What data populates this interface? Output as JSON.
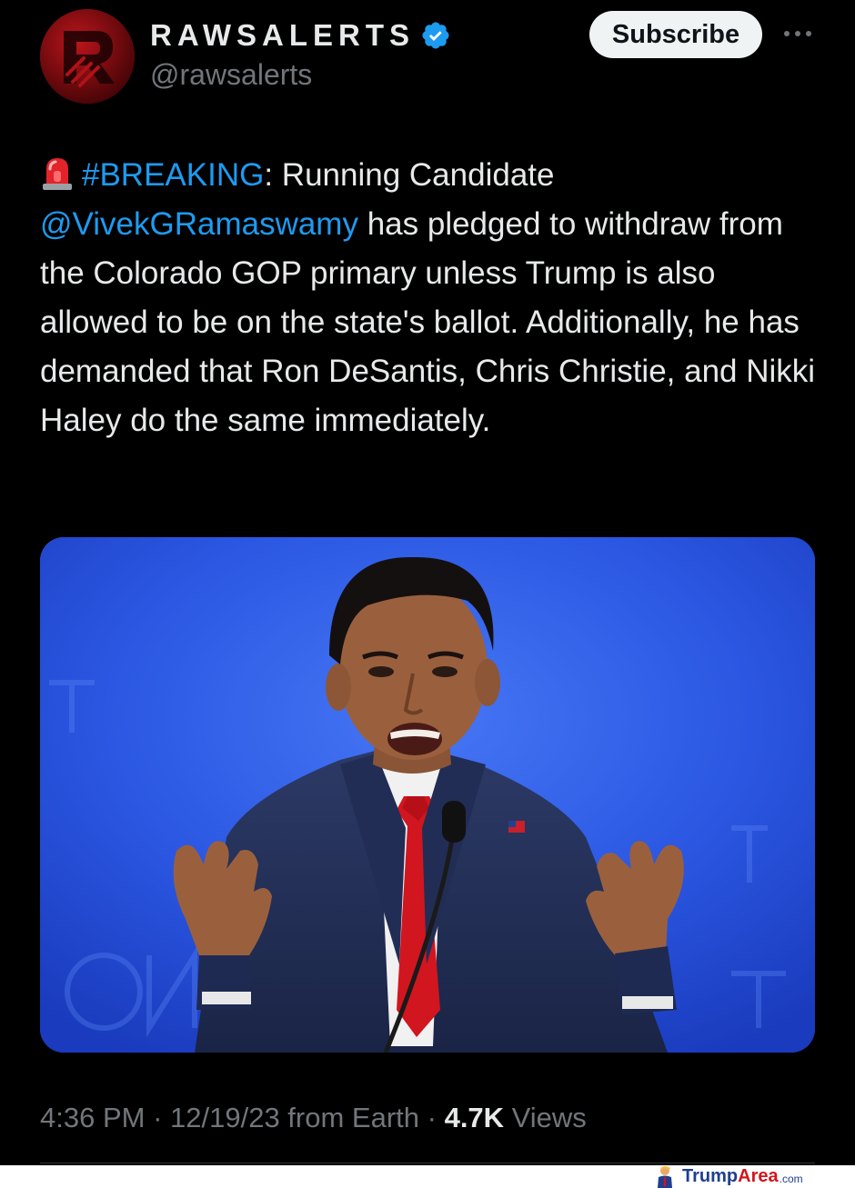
{
  "account": {
    "display_name": "RAWSALERTS",
    "handle": "@rawsalerts",
    "verified": true,
    "avatar_color": "#8b0c10"
  },
  "header": {
    "subscribe_label": "Subscribe",
    "more_icon": "more-horizontal-icon"
  },
  "tweet": {
    "emoji_icon": "police-siren-icon",
    "hashtag": "#BREAKING",
    "after_hashtag": ": Running Candidate ",
    "mention": "@VivekGRamaswamy",
    "body": " has pledged to withdraw from the Colorado GOP primary unless Trump is also allowed to be on the state's ballot. Additionally, he has demanded that Ron DeSantis, Chris Christie, and Nikki Haley do the same immediately.",
    "link_color": "#1d9bf0"
  },
  "media": {
    "type": "photo",
    "background_color": "#2a55e0"
  },
  "meta": {
    "time": "4:36 PM",
    "separator": " · ",
    "date_source": "12/19/23 from Earth",
    "views_count": "4.7K",
    "views_label": " Views"
  },
  "watermark": {
    "part1": "Trump",
    "part2": "Area",
    "part3": ".com"
  }
}
